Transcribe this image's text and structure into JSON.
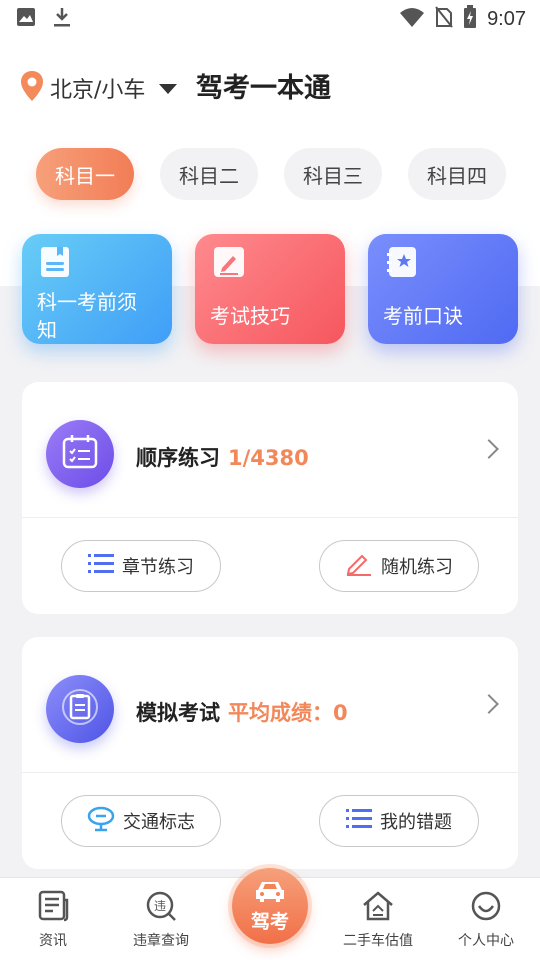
{
  "status_bar": {
    "time": "9:07"
  },
  "header": {
    "location": "北京/小车",
    "app_title": "驾考一本通"
  },
  "subject_tabs": [
    {
      "label": "科目一",
      "active": true
    },
    {
      "label": "科目二",
      "active": false
    },
    {
      "label": "科目三",
      "active": false
    },
    {
      "label": "科目四",
      "active": false
    }
  ],
  "feature_cards": [
    {
      "label_line1": "科一考前须",
      "label_line2": "知",
      "icon": "bookmark-doc-icon",
      "color": "#3f9ef7"
    },
    {
      "label": "考试技巧",
      "icon": "edit-pen-icon",
      "color": "#f6575e"
    },
    {
      "label": "考前口诀",
      "icon": "star-notebook-icon",
      "color": "#4f6af3"
    }
  ],
  "practice": {
    "title": "顺序练习",
    "progress": "1/4380",
    "buttons": [
      {
        "label": "章节练习",
        "icon": "list-icon"
      },
      {
        "label": "随机练习",
        "icon": "pencil-icon"
      }
    ]
  },
  "exam": {
    "title": "模拟考试",
    "score_label": "平均成绩：0",
    "buttons": [
      {
        "label": "交通标志",
        "icon": "traffic-sign-icon"
      },
      {
        "label": "我的错题",
        "icon": "list-icon"
      }
    ]
  },
  "bottom_nav": [
    {
      "label": "资讯",
      "icon": "news-icon"
    },
    {
      "label": "违章查询",
      "icon": "violation-search-icon"
    },
    {
      "label": "驾考",
      "icon": "car-icon",
      "active": true
    },
    {
      "label": "二手车估值",
      "icon": "home-valuation-icon"
    },
    {
      "label": "个人中心",
      "icon": "profile-icon"
    }
  ],
  "colors": {
    "accent": "#f27d56",
    "blue": "#3f9ef7",
    "red": "#f6575e",
    "indigo": "#4f6af3"
  }
}
